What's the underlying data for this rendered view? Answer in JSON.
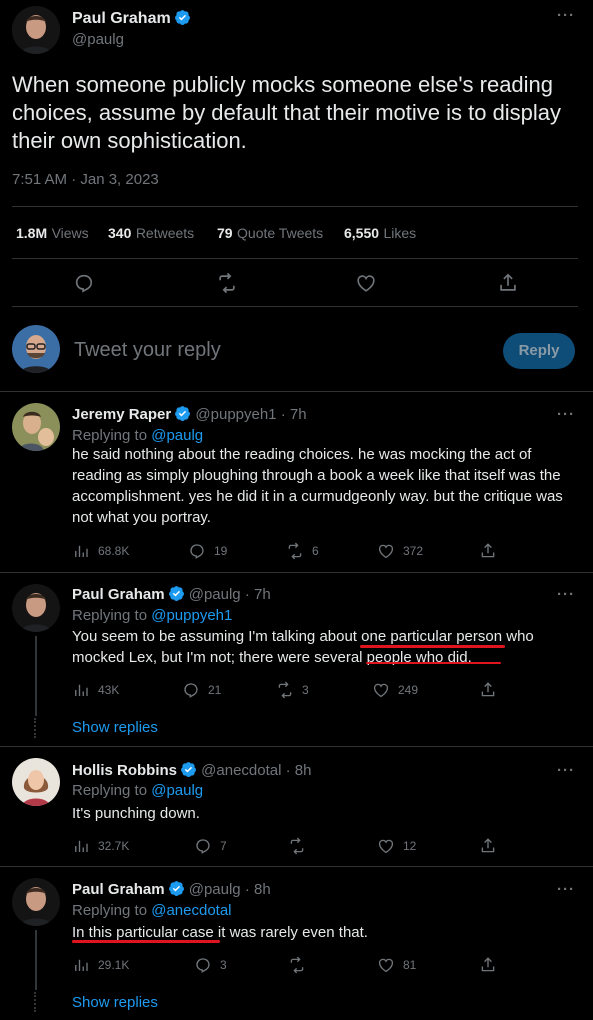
{
  "main": {
    "author_name": "Paul Graham",
    "author_handle": "@paulg",
    "text": "When someone publicly mocks someone else's reading choices, assume by default that their motive is to display their own sophistication.",
    "timestamp": "7:51 AM · Jan 3, 2023",
    "stats": {
      "views_num": "1.8M",
      "views_label": "Views",
      "retweets_num": "340",
      "retweets_label": "Retweets",
      "quotes_num": "79",
      "quotes_label": "Quote Tweets",
      "likes_num": "6,550",
      "likes_label": "Likes"
    }
  },
  "compose": {
    "placeholder": "Tweet your reply",
    "button": "Reply"
  },
  "replies": [
    {
      "name": "Jeremy Raper",
      "handle": "@puppyeh1",
      "time": "· 7h",
      "replying_prefix": "Replying to",
      "replying_to": "@paulg",
      "text": "he said nothing about the reading choices. he was mocking the act of reading as simply ploughing through a book a week like that itself was the accomplishment. yes he did it in a curmudgeonly way. but the critique was not what you portray.",
      "views": "68.8K",
      "replies": "19",
      "retweets": "6",
      "likes": "372"
    },
    {
      "name": "Paul Graham",
      "handle": "@paulg",
      "time": "· 7h",
      "replying_prefix": "Replying to",
      "replying_to": "@puppyeh1",
      "text": "You seem to be assuming I'm talking about one particular person who mocked Lex, but I'm not; there were several people who did.",
      "views": "43K",
      "replies": "21",
      "retweets": "3",
      "likes": "249"
    },
    {
      "name": "Hollis Robbins",
      "handle": "@anecdotal",
      "time": "· 8h",
      "replying_prefix": "Replying to",
      "replying_to": "@paulg",
      "text": "It's punching down.",
      "views": "32.7K",
      "replies": "7",
      "retweets": "",
      "likes": "12"
    },
    {
      "name": "Paul Graham",
      "handle": "@paulg",
      "time": "· 8h",
      "replying_prefix": "Replying to",
      "replying_to": "@anecdotal",
      "text": "In this particular case it was rarely even that.",
      "views": "29.1K",
      "replies": "3",
      "retweets": "",
      "likes": "81"
    }
  ],
  "show_replies": "Show replies",
  "colors": {
    "accent": "#1d9bf0",
    "background": "#000000",
    "muted": "#71767b",
    "annotation": "#e0141e"
  }
}
